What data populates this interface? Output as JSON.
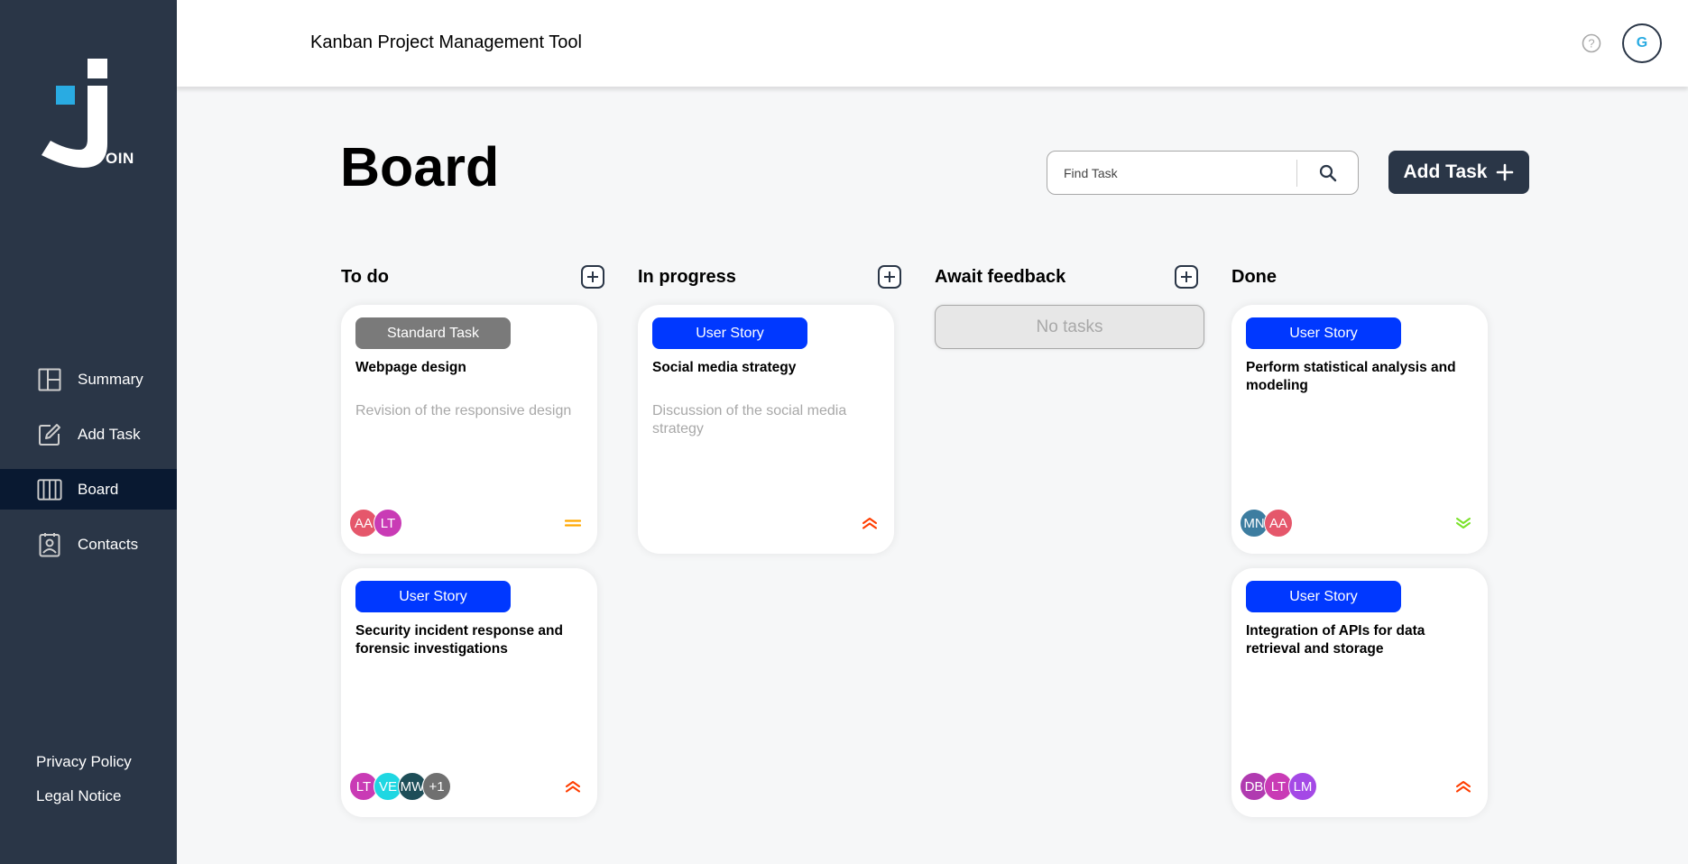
{
  "header": {
    "title": "Kanban Project Management Tool",
    "user_initial": "G"
  },
  "logo": {
    "text": "OIN"
  },
  "sidebar": {
    "items": [
      {
        "label": "Summary",
        "icon": "summary-icon"
      },
      {
        "label": "Add Task",
        "icon": "add-task-icon"
      },
      {
        "label": "Board",
        "icon": "board-icon",
        "active": true
      },
      {
        "label": "Contacts",
        "icon": "contacts-icon"
      }
    ],
    "legal": [
      "Privacy Policy",
      "Legal Notice"
    ]
  },
  "board": {
    "title": "Board",
    "search_placeholder": "Find Task",
    "add_task_label": "Add Task"
  },
  "columns": [
    {
      "title": "To do",
      "has_add": true
    },
    {
      "title": "In progress",
      "has_add": true
    },
    {
      "title": "Await feedback",
      "has_add": true,
      "empty_text": "No tasks"
    },
    {
      "title": "Done",
      "has_add": false
    }
  ],
  "cards": {
    "todo_1": {
      "category": "Standard Task",
      "title": "Webpage design",
      "description": "Revision of the responsive design",
      "assignees": [
        "AA",
        "LT"
      ],
      "priority": "medium"
    },
    "todo_2": {
      "category": "User Story",
      "title": "Security incident response and forensic investigations",
      "description": "",
      "assignees": [
        "LT",
        "VE",
        "MW",
        "+1"
      ],
      "priority": "urgent"
    },
    "progress_1": {
      "category": "User Story",
      "title": "Social media strategy",
      "description": "Discussion of the social media strategy",
      "assignees": [],
      "priority": "urgent"
    },
    "done_1": {
      "category": "User Story",
      "title": "Perform statistical analysis and modeling",
      "description": "",
      "assignees": [
        "MN",
        "AA"
      ],
      "priority": "low"
    },
    "done_2": {
      "category": "User Story",
      "title": "Integration of APIs for data retrieval and storage",
      "description": "",
      "assignees": [
        "DB",
        "LT",
        "LM"
      ],
      "priority": "urgent"
    }
  },
  "colors": {
    "sidebar": "#2A3647",
    "active_nav": "#091931",
    "user_story": "#0038FF",
    "standard_task": "#7A7A7A",
    "urgent": "#FF3D00",
    "medium": "#FFA800",
    "low": "#7AE229",
    "avatars": {
      "AA": "#E5576B",
      "LT": "#C93BB5",
      "VE": "#1FD7E2",
      "MW": "#1E4E58",
      "+1": "#707070",
      "MN": "#3D7DA0",
      "DB": "#B03BB0",
      "LM": "#A449E6"
    }
  }
}
